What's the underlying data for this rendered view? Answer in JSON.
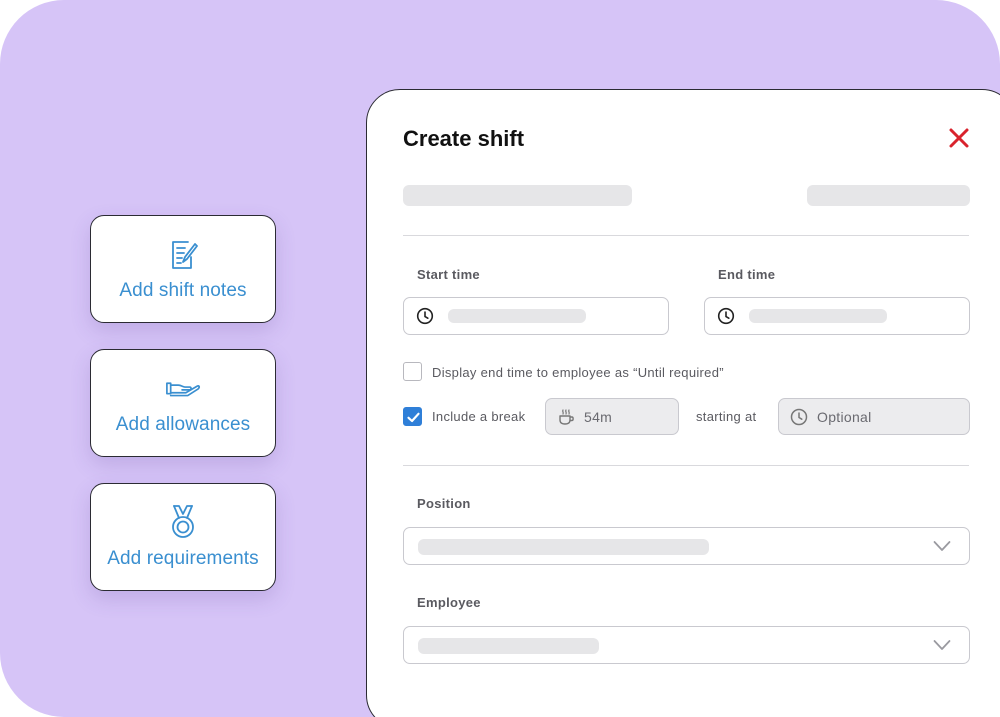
{
  "actions": [
    {
      "label": "Add shift notes",
      "icon": "document-edit-icon"
    },
    {
      "label": "Add allowances",
      "icon": "hand-give-icon"
    },
    {
      "label": "Add requirements",
      "icon": "medal-icon"
    }
  ],
  "modal": {
    "title": "Create shift",
    "close_icon": "close-icon",
    "start_time_label": "Start time",
    "end_time_label": "End time",
    "display_end_time_label": "Display end time to employee as “Until required”",
    "display_end_time_checked": false,
    "include_break_label": "Include a break",
    "include_break_checked": true,
    "break_duration": "54m",
    "starting_at_label": "starting at",
    "break_start_placeholder": "Optional",
    "position_label": "Position",
    "employee_label": "Employee"
  },
  "colors": {
    "background": "#d6c4f7",
    "accent_blue": "#3a8fd0",
    "checkbox_blue": "#2f7fd8",
    "close_red": "#d9232d"
  }
}
